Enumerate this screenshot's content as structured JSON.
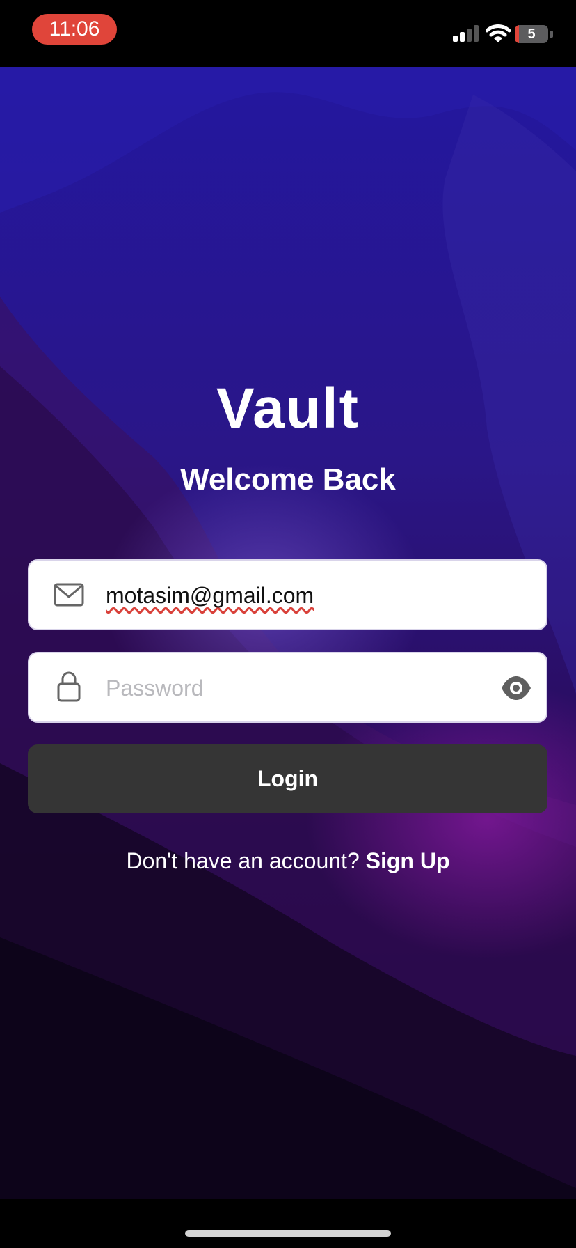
{
  "status_bar": {
    "time": "11:06",
    "battery_level": "5",
    "time_pill_color": "#e0453a"
  },
  "app": {
    "title": "Vault",
    "subtitle": "Welcome Back"
  },
  "form": {
    "email_value": "motasim@gmail.com",
    "password_placeholder": "Password",
    "login_label": "Login"
  },
  "footer": {
    "prompt": "Don't have an account?",
    "signup_label": "Sign Up"
  },
  "icons": {
    "email": "envelope-icon",
    "password": "lock-icon",
    "toggle_visibility": "eye-icon"
  },
  "colors": {
    "button": "#353535",
    "background_top": "#23179f",
    "background_bottom": "#120624"
  }
}
